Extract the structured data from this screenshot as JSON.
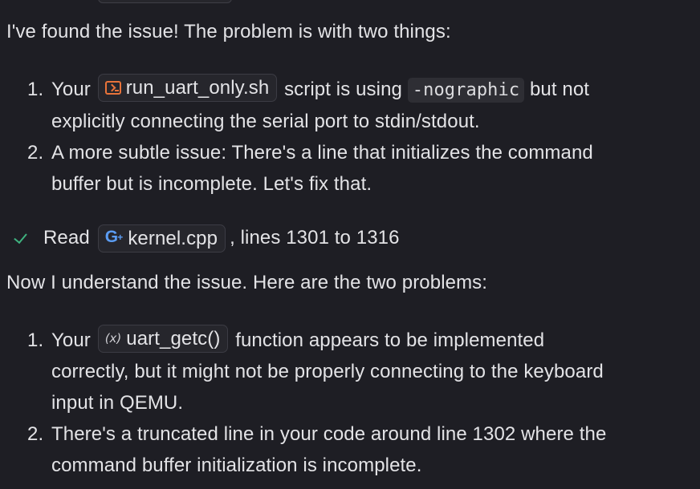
{
  "message1": {
    "intro": "I've found the issue! The problem is with two things:",
    "items": [
      {
        "number": "1.",
        "before": "Your",
        "chip_icon": "terminal-icon",
        "chip_label": "run_uart_only.sh",
        "middle": "script is using",
        "code": "-nographic",
        "after_line1": "but not",
        "line2": "explicitly connecting the serial port to stdin/stdout."
      },
      {
        "number": "2.",
        "line1": "A more subtle issue: There's a line that initializes the command",
        "line2": "buffer but is incomplete. Let's fix that."
      }
    ]
  },
  "read_status": {
    "icon": "check-icon",
    "status_color": "#3fb27f",
    "verb": "Read",
    "file_icon": "cpp-file-icon",
    "file_icon_text": "G",
    "file_icon_plus": "+",
    "file_name": "kernel.cpp",
    "range": ", lines 1301 to 1316"
  },
  "message2": {
    "intro": "Now I understand the issue. Here are the two problems:",
    "items": [
      {
        "number": "1.",
        "before": "Your",
        "chip_icon_text": "(x)",
        "chip_label": "uart_getc()",
        "after_line1": "function appears to be implemented",
        "line2": "correctly, but it might not be properly connecting to the keyboard",
        "line3": "input in QEMU."
      },
      {
        "number": "2.",
        "line1": "There's a truncated line in your code around line 1302 where the",
        "line2": "command buffer initialization is incomplete."
      }
    ]
  },
  "colors": {
    "background": "#1e1e24",
    "text": "#e3e3e6",
    "chip_border": "#3c3c44",
    "terminal_icon": "#e8733a",
    "cpp_icon": "#5b9cf2"
  }
}
